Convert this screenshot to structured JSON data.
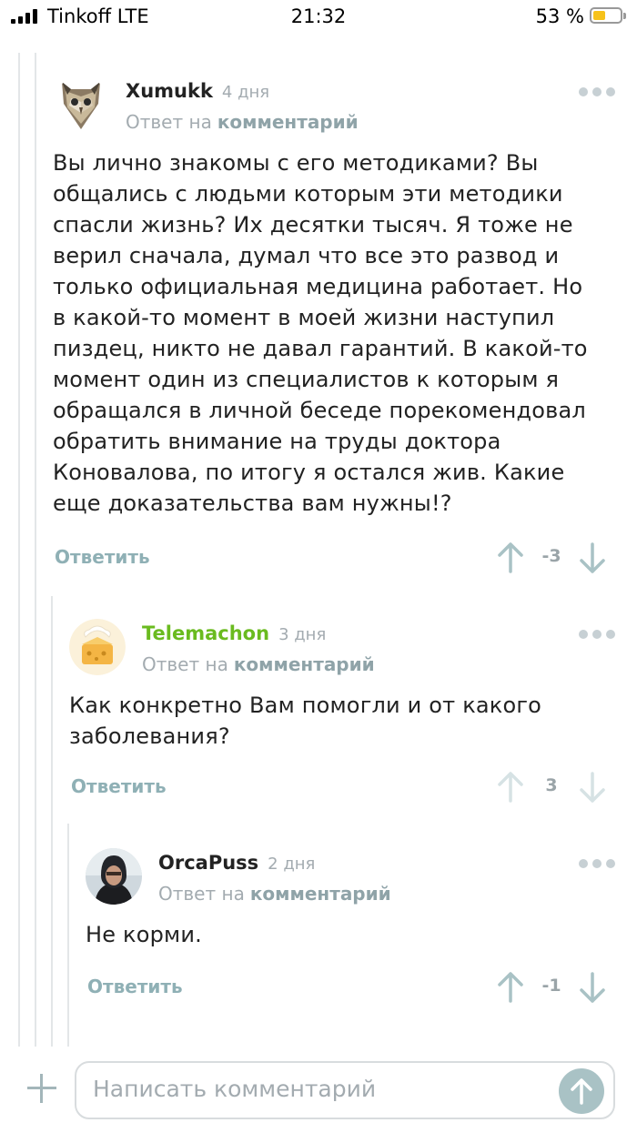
{
  "status_bar": {
    "carrier": "Tinkoff LTE",
    "time": "21:32",
    "battery": "53 %",
    "battery_color": "#f6c21a"
  },
  "comments": [
    {
      "author": "Xumukk",
      "ago": "4 дня",
      "reply_prefix": "Ответ на",
      "reply_link": "комментарий",
      "body": [
        "Вы лично знакомы с его методиками? Вы",
        "общались с людьми которым эти методики",
        "спасли жизнь? Их десятки тысяч. Я тоже не",
        "верил сначала, думал что все это развод и",
        "только официальная медицина работает. Но",
        "в какой-то момент в моей жизни наступил",
        "пиздец, никто не давал гарантий. В какой-то",
        "момент один из специалистов к которым я",
        "обращался в личной беседе порекомендовал",
        "обратить внимание на труды доктора",
        "Коновалова, по итогу я остался жив. Какие",
        "еще доказательства вам нужны!?"
      ],
      "reply_label": "Ответить",
      "score": "-3",
      "avatar_icon": "owl-avatar"
    },
    {
      "author": "Telemachon",
      "ago": "3 дня",
      "reply_prefix": "Ответ на",
      "reply_link": "комментарий",
      "body": [
        "Как конкретно Вам помогли и от какого",
        "заболевания?"
      ],
      "reply_label": "Ответить",
      "score": "3",
      "avatar_icon": "cheese-avatar",
      "author_color": "#6abb1f"
    },
    {
      "author": "OrcaPuss",
      "ago": "2 дня",
      "reply_prefix": "Ответ на",
      "reply_link": "комментарий",
      "body": [
        "Не корми."
      ],
      "reply_label": "Ответить",
      "score": "-1",
      "avatar_icon": "user-photo-avatar"
    }
  ],
  "composer": {
    "placeholder": "Написать комментарий"
  }
}
